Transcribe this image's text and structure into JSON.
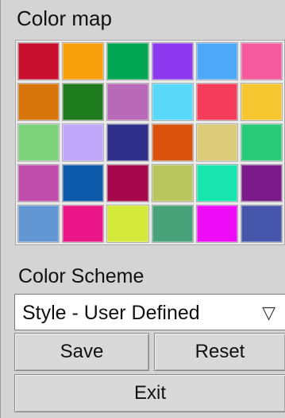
{
  "color_map": {
    "title": "Color map",
    "swatches": [
      "#c8102e",
      "#f7a00c",
      "#00a651",
      "#8b38ef",
      "#4da8f7",
      "#f45a9c",
      "#d8750a",
      "#1e7b1e",
      "#b86ab9",
      "#5ad8fa",
      "#f53c5a",
      "#f5c630",
      "#7bd27b",
      "#c1a7fa",
      "#2d2d8a",
      "#d9520c",
      "#dccb78",
      "#28c979",
      "#c04dab",
      "#0b59a8",
      "#a6064a",
      "#b8c65d",
      "#18e4ad",
      "#7b1b8a",
      "#6397d4",
      "#ea1586",
      "#d4e83a",
      "#47a27a",
      "#ee0cf6",
      "#4656aa"
    ]
  },
  "color_scheme": {
    "label": "Color Scheme",
    "selected": "Style - User Defined",
    "arrow_glyph": "▽"
  },
  "buttons": {
    "save": "Save",
    "reset": "Reset",
    "exit": "Exit"
  }
}
